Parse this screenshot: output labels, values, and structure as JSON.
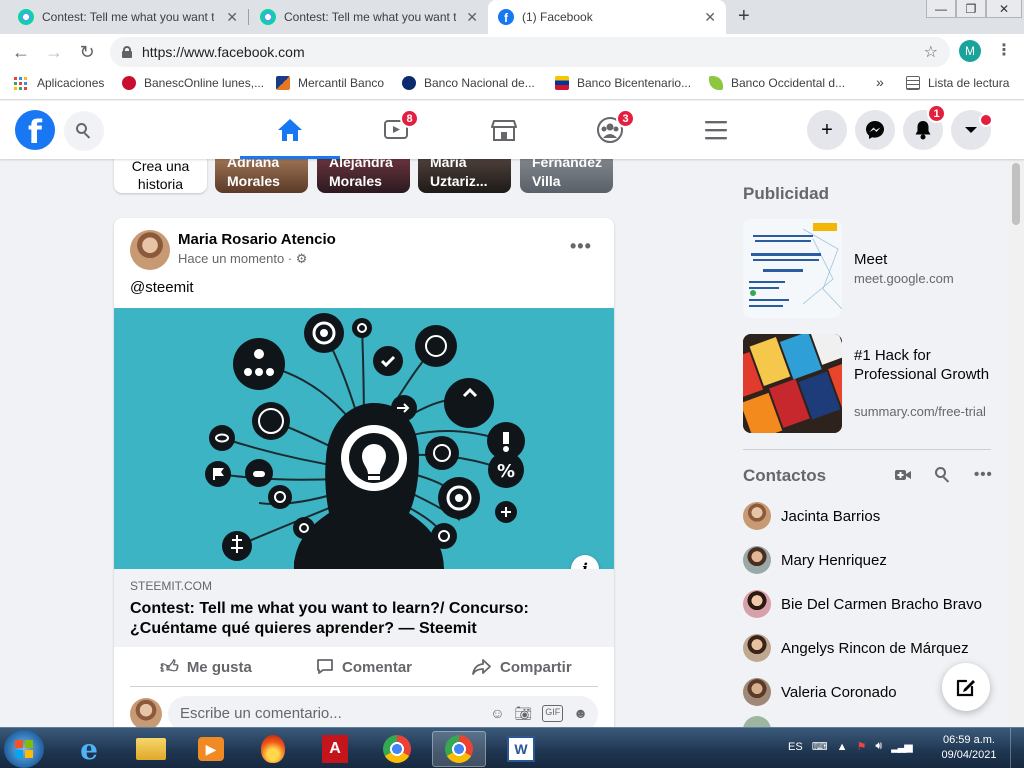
{
  "browser": {
    "tabs": [
      {
        "label": "Contest: Tell me what you want to learn?/ Concurso",
        "favicon": "steemit-icon"
      },
      {
        "label": "Contest: Tell me what you want to learn?/ Concurso",
        "favicon": "steemit-icon"
      },
      {
        "label": "(1) Facebook",
        "favicon": "facebook-icon",
        "active": true
      }
    ],
    "url": "https://www.facebook.com",
    "profile_initial": "M",
    "bookmarks": [
      {
        "label": "Aplicaciones"
      },
      {
        "label": "BanescOnline lunes,..."
      },
      {
        "label": "Mercantil Banco"
      },
      {
        "label": "Banco Nacional de..."
      },
      {
        "label": "Banco Bicentenario..."
      },
      {
        "label": "Banco Occidental d..."
      }
    ],
    "bookmarks_overflow": "»",
    "reading_list": "Lista de lectura"
  },
  "fb": {
    "badges": {
      "watch": "8",
      "groups": "3",
      "notifications": "1"
    },
    "stories": [
      {
        "label": "Crea una historia"
      },
      {
        "label": "Adriana Morales"
      },
      {
        "label": "Alejandra Morales"
      },
      {
        "label": "María Uztariz..."
      },
      {
        "label": "Fernandez Villa"
      }
    ],
    "post": {
      "author": "Maria Rosario Atencio",
      "time": "Hace un momento ·",
      "text": "@steemit",
      "link_domain": "STEEMIT.COM",
      "link_title": "Contest: Tell me what you want to learn?/ Concurso: ¿Cuéntame qué quieres aprender? — Steemit",
      "actions": {
        "like": "Me gusta",
        "comment": "Comentar",
        "share": "Compartir"
      },
      "comment_placeholder": "Escribe un comentario..."
    },
    "sponsored": {
      "title": "Publicidad",
      "ads": [
        {
          "title": "Meet",
          "domain": "meet.google.com"
        },
        {
          "title": "#1 Hack for Professional Growth",
          "domain": "summary.com/free-trial"
        }
      ]
    },
    "contacts": {
      "title": "Contactos",
      "people": [
        "Jacinta Barrios",
        "Mary Henriquez",
        "Bie Del Carmen Bracho Bravo",
        "Angelys Rincon de Márquez",
        "Valeria Coronado"
      ]
    }
  },
  "taskbar": {
    "language": "ES",
    "time": "06:59 a.m.",
    "date": "09/04/2021"
  },
  "colors": {
    "fb_blue": "#1877f2",
    "badge_red": "#e41e3f",
    "post_image_bg": "#3cb4c4"
  }
}
